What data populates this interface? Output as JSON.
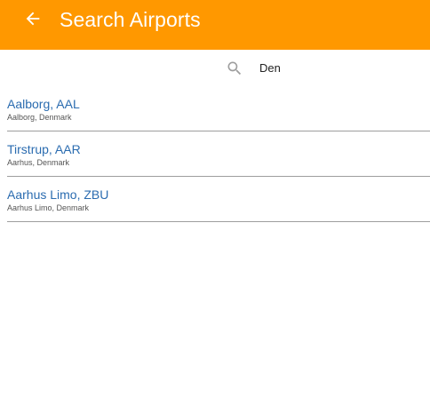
{
  "header": {
    "title": "Search Airports",
    "back_icon": "arrow-left-icon",
    "background_color": "#FF9800",
    "title_color": "#FFFFFF"
  },
  "search": {
    "icon": "search-icon",
    "value": "Den",
    "placeholder": ""
  },
  "results": [
    {
      "name": "Aalborg, AAL",
      "subtitle": "Aalborg, Denmark"
    },
    {
      "name": "Tirstrup, AAR",
      "subtitle": "Aarhus, Denmark"
    },
    {
      "name": "Aarhus Limo, ZBU",
      "subtitle": "Aarhus Limo, Denmark"
    }
  ],
  "colors": {
    "link": "#2B6CB0",
    "divider": "#9E9E9E",
    "icon_gray": "#9E9E9E"
  }
}
